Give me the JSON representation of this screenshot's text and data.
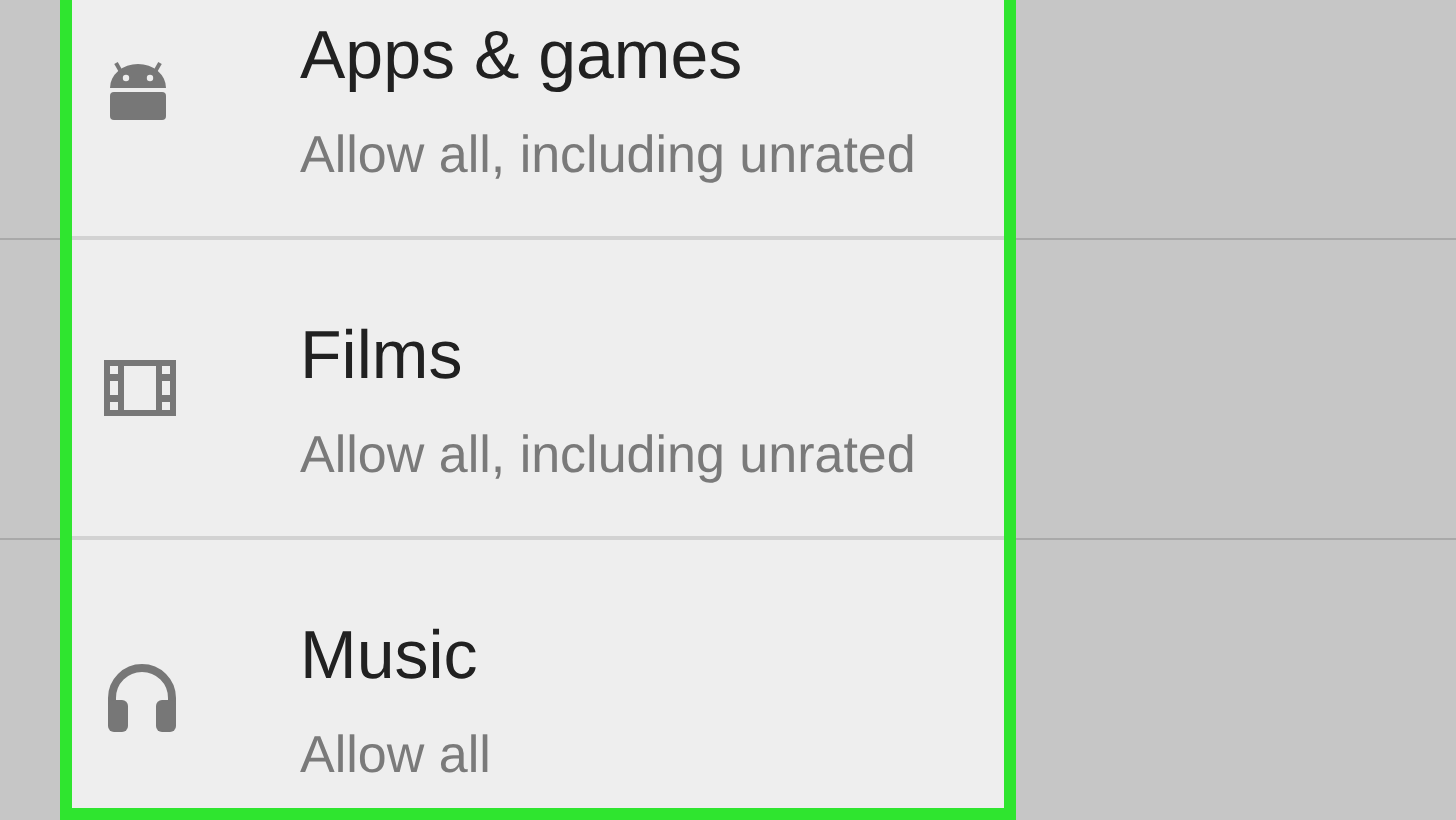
{
  "items": [
    {
      "kind": "android",
      "title": "Apps & games",
      "subtitle": "Allow all, including unrated"
    },
    {
      "kind": "film",
      "title": "Films",
      "subtitle": "Allow all, including unrated"
    },
    {
      "kind": "headphones",
      "title": "Music",
      "subtitle": "Allow all"
    }
  ]
}
